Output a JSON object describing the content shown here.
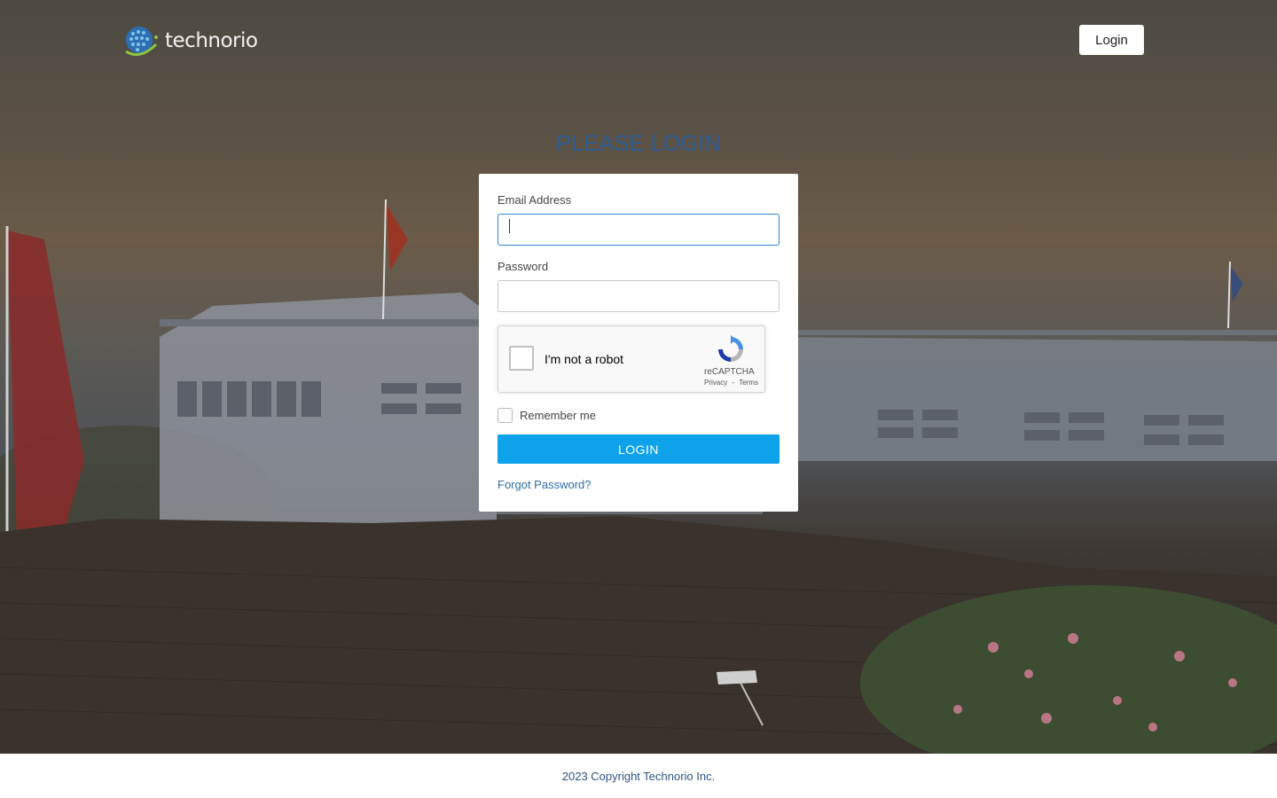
{
  "brand": {
    "name": "technorio",
    "logo_icon": "globe-logo-icon"
  },
  "header": {
    "login_button": "Login"
  },
  "page": {
    "heading": "PLEASE LOGIN"
  },
  "form": {
    "email_label": "Email Address",
    "email_value": "",
    "password_label": "Password",
    "password_value": "",
    "captcha": {
      "label": "I'm not a robot",
      "brand": "reCAPTCHA",
      "privacy": "Privacy",
      "separator": "-",
      "terms": "Terms",
      "icon": "recaptcha-icon"
    },
    "remember_label": "Remember me",
    "submit_label": "LOGIN",
    "forgot_label": "Forgot Password?"
  },
  "footer": {
    "copyright": "2023 Copyright Technorio Inc."
  },
  "colors": {
    "heading": "#2d5e96",
    "submit_bg": "#0ea2ea",
    "link": "#2d6ea8",
    "footer_text": "#2d5486",
    "focus_border": "#2a86d0"
  }
}
